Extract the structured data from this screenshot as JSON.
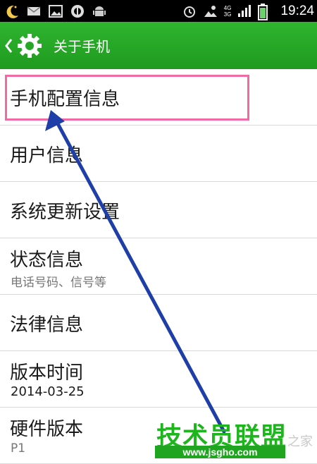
{
  "status_bar": {
    "time": "19:24",
    "network_top": "4G",
    "network_bottom": "3G",
    "icons": [
      "moon-icon",
      "mail-icon",
      "image-icon",
      "circle-app-icon",
      "android-icon",
      "alarm-icon",
      "weather-icon",
      "signal-icon",
      "battery-icon"
    ]
  },
  "header": {
    "title": "关于手机",
    "icons": [
      "back-chevron-icon",
      "gear-icon"
    ]
  },
  "list": {
    "items": [
      {
        "label": "手机配置信息"
      },
      {
        "label": "用户信息"
      },
      {
        "label": "系统更新设置"
      },
      {
        "label": "状态信息",
        "sub": "电话号码、信号等"
      },
      {
        "label": "法律信息"
      },
      {
        "label": "版本时间",
        "sub": "2014-03-25"
      },
      {
        "label": "硬件版本",
        "sub": "P1"
      }
    ]
  },
  "watermark": {
    "main": "技术员联盟",
    "url": "www.jsgho.com",
    "faint": "之家"
  },
  "colors": {
    "header_green": "#26a826",
    "highlight_pink": "#f06aa4",
    "arrow_blue": "#1f3fa8"
  }
}
